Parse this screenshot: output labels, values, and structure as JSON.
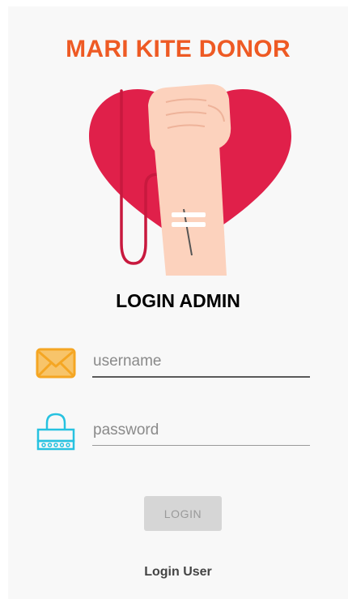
{
  "header": {
    "app_title": "MARI KITE DONOR"
  },
  "hero": {
    "icon": "blood-donation-heart-illustration",
    "colors": {
      "heart": "#e0204a",
      "skin": "#fcd2bd",
      "tube": "#c8193e"
    }
  },
  "login": {
    "title": "LOGIN ADMIN",
    "username": {
      "placeholder": "username",
      "value": "",
      "icon": "envelope-icon"
    },
    "password": {
      "placeholder": "password",
      "value": "",
      "icon": "lock-icon"
    },
    "login_button_label": "LOGIN",
    "switch_link_label": "Login User"
  },
  "colors": {
    "accent": "#ee5a24",
    "envelope": "#f5a623",
    "lock": "#27c2e0",
    "button_bg": "#d6d6d6"
  }
}
